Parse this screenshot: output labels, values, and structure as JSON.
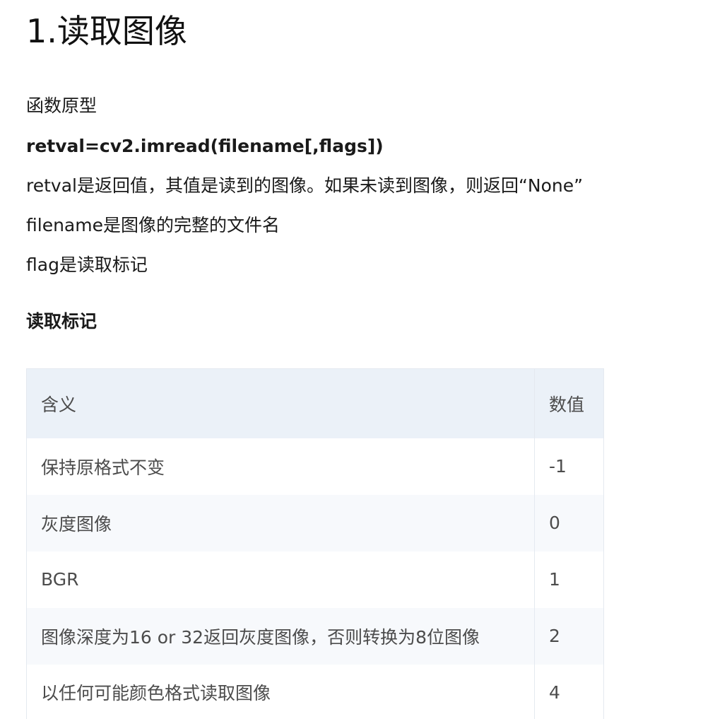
{
  "heading": "1.读取图像",
  "paragraphs": {
    "prototype_label": "函数原型",
    "signature": "retval=cv2.imread(filename[,flags])",
    "retval_desc": "retval是返回值，其值是读到的图像。如果未读到图像，则返回“None”",
    "filename_desc": "filename是图像的完整的文件名",
    "flag_desc": "flag是读取标记"
  },
  "subheading": "读取标记",
  "table": {
    "headers": [
      "含义",
      "数值"
    ],
    "rows": [
      {
        "meaning": "保持原格式不变",
        "value": "-1"
      },
      {
        "meaning": "灰度图像",
        "value": "0"
      },
      {
        "meaning": "BGR",
        "value": "1"
      },
      {
        "meaning": "图像深度为16 or 32返回灰度图像，否则转换为8位图像",
        "value": "2"
      },
      {
        "meaning": "以任何可能颜色格式读取图像",
        "value": "4"
      }
    ]
  }
}
